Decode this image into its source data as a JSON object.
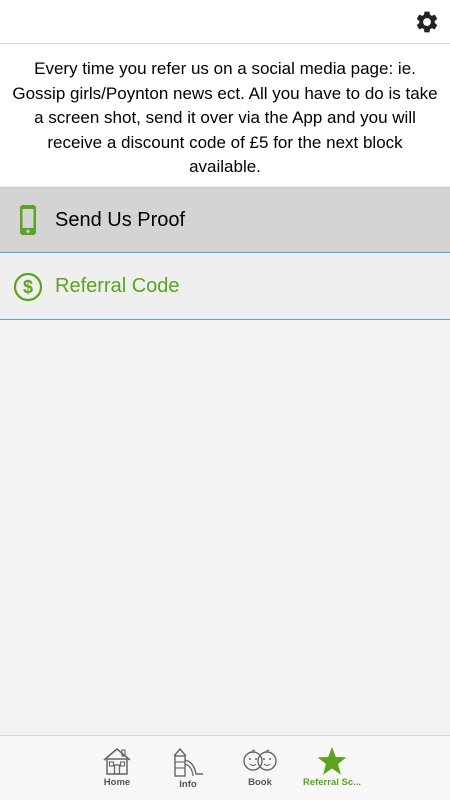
{
  "header": {
    "settings_icon": "gear-icon"
  },
  "intro": {
    "text": "Every time you refer us on a social media page: ie. Gossip girls/Poynton news ect. All you have to do is take a screen shot, send it over via the App and you will receive a discount code of £5 for the next block available."
  },
  "menu": {
    "items": [
      {
        "label": "Send Us Proof",
        "icon": "phone-icon",
        "selected": true
      },
      {
        "label": "Referral Code",
        "icon": "dollar-circle-icon",
        "selected": false
      }
    ]
  },
  "tabbar": {
    "tabs": [
      {
        "label": "Home",
        "icon": "house-icon",
        "active": false
      },
      {
        "label": "Info",
        "icon": "playground-icon",
        "active": false
      },
      {
        "label": "Book",
        "icon": "baby-faces-icon",
        "active": false
      },
      {
        "label": "Referral Sc...",
        "icon": "star-icon",
        "active": true
      }
    ]
  },
  "colors": {
    "accent_green": "#5aa51d",
    "divider_blue": "#4aa8e8",
    "selected_row": "#d4d4d4"
  }
}
